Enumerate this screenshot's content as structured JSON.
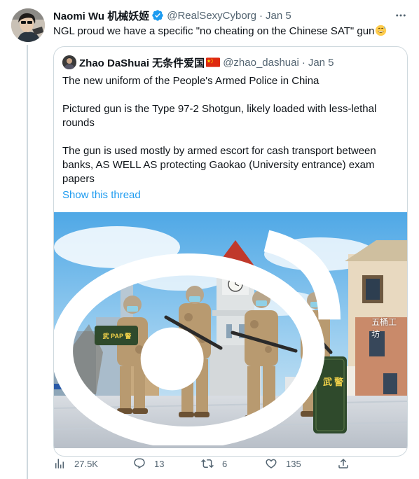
{
  "tweet": {
    "author_name": "Naomi Wu 机械妖姬",
    "author_handle": "@RealSexyCyborg",
    "separator": "·",
    "date": "Jan 5",
    "text": "NGL proud we have a specific \"no cheating on the Chinese SAT\" gun",
    "emoji": "grinning-sweat-emoji"
  },
  "quote": {
    "author_name": "Zhao DaShuai 无条件爱国",
    "flag": "china-flag",
    "author_handle": "@zhao_dashuai",
    "separator": "·",
    "date": "Jan 5",
    "paragraphs": [
      "The new uniform of the People's Armed Police in China",
      "Pictured gun is the Type 97-2 Shotgun, likely loaded with less-lethal rounds",
      "The gun is used mostly by armed escort for cash transport between banks, AS WELL AS protecting Gaokao (University entrance) exam papers"
    ],
    "show_thread": "Show this thread",
    "image_watermark": "五桶工坊",
    "sign_left": "武 PAP 警",
    "shield_text_1": "武",
    "shield_text_2": "警"
  },
  "actions": {
    "views": "27.5K",
    "replies": "13",
    "retweets": "6",
    "likes": "135"
  },
  "colors": {
    "accent": "#1d9bf0",
    "secondary_text": "#536471",
    "border": "#cfd9de"
  }
}
